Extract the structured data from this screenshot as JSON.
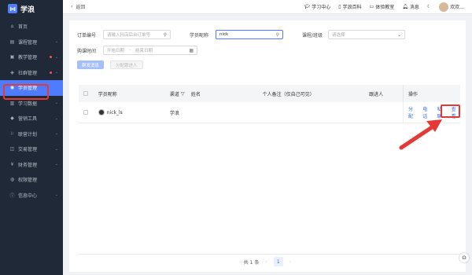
{
  "app": {
    "logo_text": "学浪"
  },
  "sidebar": {
    "items": [
      {
        "label": "首页",
        "icon": "home-icon",
        "has_chevron": false,
        "dot": false,
        "active": false
      },
      {
        "label": "课程管理",
        "icon": "course-icon",
        "has_chevron": true,
        "dot": false,
        "active": false
      },
      {
        "label": "教学管理",
        "icon": "teaching-icon",
        "has_chevron": true,
        "dot": true,
        "active": false
      },
      {
        "label": "社群管理",
        "icon": "community-icon",
        "has_chevron": true,
        "dot": true,
        "active": false
      },
      {
        "label": "学员管理",
        "icon": "student-icon",
        "has_chevron": false,
        "dot": false,
        "active": true
      },
      {
        "label": "学习数据",
        "icon": "data-icon",
        "has_chevron": true,
        "dot": false,
        "active": false
      },
      {
        "label": "营销工具",
        "icon": "marketing-icon",
        "has_chevron": true,
        "dot": false,
        "active": false
      },
      {
        "label": "联营计划",
        "icon": "alliance-icon",
        "has_chevron": true,
        "dot": false,
        "active": false
      },
      {
        "label": "交易管理",
        "icon": "trade-icon",
        "has_chevron": true,
        "dot": false,
        "active": false
      },
      {
        "label": "财务管理",
        "icon": "finance-icon",
        "has_chevron": true,
        "dot": false,
        "active": false
      },
      {
        "label": "权限管理",
        "icon": "permission-icon",
        "has_chevron": false,
        "dot": false,
        "active": false
      },
      {
        "label": "信息中心",
        "icon": "info-icon",
        "has_chevron": true,
        "dot": false,
        "active": false
      }
    ],
    "active_color": "#4f7cff"
  },
  "topbar": {
    "back_label": "返回",
    "links": [
      {
        "label": "学习中心",
        "icon": "graduation-cap-icon"
      },
      {
        "label": "学浪百科",
        "icon": "book-icon"
      },
      {
        "label": "体验教室",
        "icon": "monitor-icon"
      },
      {
        "label": "消息",
        "icon": "bell-icon"
      }
    ],
    "user_label": "欢欢..."
  },
  "filters": {
    "order_label": "订单编号",
    "order_placeholder": "请输入抖店后台订单号",
    "nickname_label": "学员昵称",
    "nickname_value": "nick",
    "course_label": "课程/班级",
    "course_placeholder": "请选择",
    "time_label": "购课时间",
    "start_placeholder": "开始日期",
    "range_sep": "-",
    "end_placeholder": "结束日期"
  },
  "actions": {
    "primary_label": "群发消息",
    "secondary_label": "分配跟进人"
  },
  "table": {
    "headers": {
      "name": "学员昵称",
      "channel": "渠道",
      "realname": "姓名",
      "remark": "个人备注（仅自己可见）",
      "follower": "跟进人",
      "ops": "操作"
    },
    "rows": [
      {
        "name": "nick_ls",
        "channel": "学浪",
        "realname": "",
        "remark": "",
        "follower": "",
        "ops": [
          "分配",
          "电话",
          "私聊",
          "查看"
        ]
      }
    ]
  },
  "pagination": {
    "total_label": "共 1 条",
    "prev": "‹",
    "page": "1",
    "next": "›"
  },
  "accent_color": "#3b6df0",
  "annotation_color": "#e53935"
}
